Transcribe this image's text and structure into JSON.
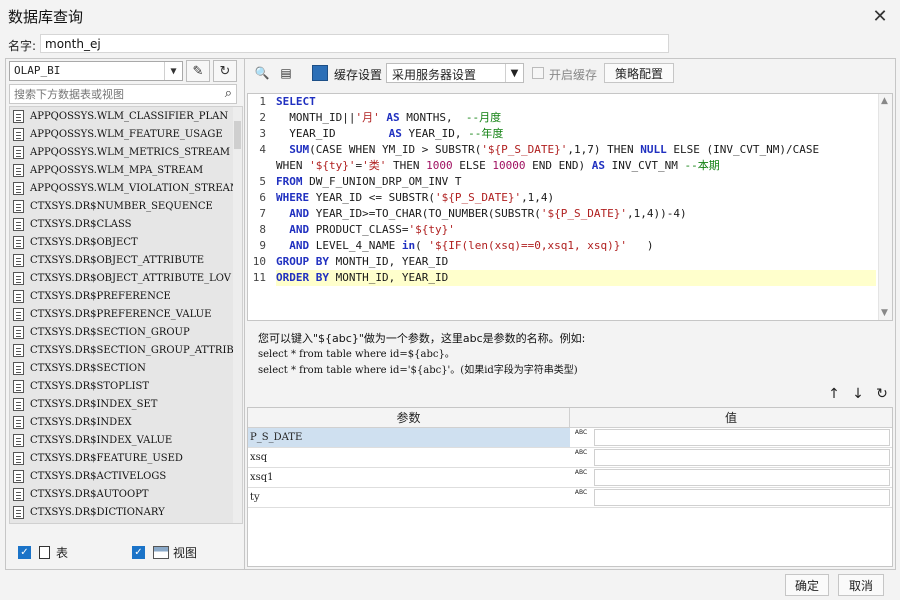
{
  "window": {
    "title": "数据库查询"
  },
  "name_field": {
    "label": "名字:",
    "value": "month_ej"
  },
  "left": {
    "datasource": "OLAP_BI",
    "search_placeholder": "搜索下方数据表或视图",
    "tables": [
      "APPQOSSYS.WLM_CLASSIFIER_PLAN",
      "APPQOSSYS.WLM_FEATURE_USAGE",
      "APPQOSSYS.WLM_METRICS_STREAM",
      "APPQOSSYS.WLM_MPA_STREAM",
      "APPQOSSYS.WLM_VIOLATION_STREAM",
      "CTXSYS.DR$NUMBER_SEQUENCE",
      "CTXSYS.DR$CLASS",
      "CTXSYS.DR$OBJECT",
      "CTXSYS.DR$OBJECT_ATTRIBUTE",
      "CTXSYS.DR$OBJECT_ATTRIBUTE_LOV",
      "CTXSYS.DR$PREFERENCE",
      "CTXSYS.DR$PREFERENCE_VALUE",
      "CTXSYS.DR$SECTION_GROUP",
      "CTXSYS.DR$SECTION_GROUP_ATTRIBUTE",
      "CTXSYS.DR$SECTION",
      "CTXSYS.DR$STOPLIST",
      "CTXSYS.DR$INDEX_SET",
      "CTXSYS.DR$INDEX",
      "CTXSYS.DR$INDEX_VALUE",
      "CTXSYS.DR$FEATURE_USED",
      "CTXSYS.DR$ACTIVELOGS",
      "CTXSYS.DR$AUTOOPT",
      "CTXSYS.DR$DICTIONARY"
    ],
    "check_table": "表",
    "check_view": "视图"
  },
  "toolbar": {
    "cache_label": "缓存设置",
    "cache_option": "采用服务器设置",
    "enable_cache": "开启缓存",
    "policy_button": "策略配置"
  },
  "editor": {
    "line_numbers": [
      "1",
      "2",
      "3",
      "4",
      "",
      "5",
      "6",
      "7",
      "8",
      "9",
      "10",
      "11"
    ],
    "lines": [
      [
        {
          "t": "kw",
          "v": "SELECT"
        }
      ],
      [
        {
          "t": "fn",
          "v": "  MONTH_ID||"
        },
        {
          "t": "str",
          "v": "'月'"
        },
        {
          "t": "fn",
          "v": " "
        },
        {
          "t": "kw",
          "v": "AS"
        },
        {
          "t": "fn",
          "v": " MONTHS,  "
        },
        {
          "t": "cm",
          "v": "--月度"
        }
      ],
      [
        {
          "t": "fn",
          "v": "  YEAR_ID        "
        },
        {
          "t": "kw",
          "v": "AS"
        },
        {
          "t": "fn",
          "v": " YEAR_ID, "
        },
        {
          "t": "cm",
          "v": "--年度"
        }
      ],
      [
        {
          "t": "fn",
          "v": "  "
        },
        {
          "t": "kw",
          "v": "SUM"
        },
        {
          "t": "fn",
          "v": "(CASE WHEN YM_ID > SUBSTR("
        },
        {
          "t": "str",
          "v": "'${P_S_DATE}'"
        },
        {
          "t": "fn",
          "v": ",1,7) THEN "
        },
        {
          "t": "kw",
          "v": "NULL"
        },
        {
          "t": "fn",
          "v": " ELSE (INV_CVT_NM)/CASE"
        }
      ],
      [
        {
          "t": "fn",
          "v": "WHEN "
        },
        {
          "t": "str",
          "v": "'${ty}'"
        },
        {
          "t": "fn",
          "v": "="
        },
        {
          "t": "str",
          "v": "'类'"
        },
        {
          "t": "fn",
          "v": " THEN "
        },
        {
          "t": "num",
          "v": "1000"
        },
        {
          "t": "fn",
          "v": " ELSE "
        },
        {
          "t": "num",
          "v": "10000"
        },
        {
          "t": "fn",
          "v": " END END) "
        },
        {
          "t": "kw",
          "v": "AS"
        },
        {
          "t": "fn",
          "v": " INV_CVT_NM "
        },
        {
          "t": "cm",
          "v": "--本期"
        }
      ],
      [
        {
          "t": "kw",
          "v": "FROM"
        },
        {
          "t": "fn",
          "v": " DW_F_UNION_DRP_OM_INV T"
        }
      ],
      [
        {
          "t": "kw",
          "v": "WHERE"
        },
        {
          "t": "fn",
          "v": " YEAR_ID <= SUBSTR("
        },
        {
          "t": "str",
          "v": "'${P_S_DATE}'"
        },
        {
          "t": "fn",
          "v": ",1,4)"
        }
      ],
      [
        {
          "t": "fn",
          "v": "  "
        },
        {
          "t": "kw",
          "v": "AND"
        },
        {
          "t": "fn",
          "v": " YEAR_ID>=TO_CHAR(TO_NUMBER(SUBSTR("
        },
        {
          "t": "str",
          "v": "'${P_S_DATE}'"
        },
        {
          "t": "fn",
          "v": ",1,4))-4)"
        }
      ],
      [
        {
          "t": "fn",
          "v": "  "
        },
        {
          "t": "kw",
          "v": "AND"
        },
        {
          "t": "fn",
          "v": " PRODUCT_CLASS="
        },
        {
          "t": "str",
          "v": "'${ty}'"
        }
      ],
      [
        {
          "t": "fn",
          "v": "  "
        },
        {
          "t": "kw",
          "v": "AND"
        },
        {
          "t": "fn",
          "v": " LEVEL_4_NAME "
        },
        {
          "t": "kw",
          "v": "in"
        },
        {
          "t": "fn",
          "v": "( "
        },
        {
          "t": "str",
          "v": "'${IF(len(xsq)==0,xsq1, xsq)}'"
        },
        {
          "t": "fn",
          "v": "   )"
        }
      ],
      [
        {
          "t": "kw",
          "v": "GROUP BY"
        },
        {
          "t": "fn",
          "v": " MONTH_ID, YEAR_ID"
        }
      ],
      [
        {
          "t": "kw",
          "v": "ORDER BY"
        },
        {
          "t": "fn",
          "v": " MONTH_ID, YEAR_ID"
        }
      ]
    ]
  },
  "help": {
    "line1": "您可以键入\"${abc}\"做为一个参数，这里abc是参数的名称。例如:",
    "line2": "select * from table where id=${abc}。",
    "line3": "select * from table where id='${abc}'。(如果id字段为字符串类型)"
  },
  "params": {
    "col_param": "参数",
    "col_value": "值",
    "type_label": "ABC",
    "rows": [
      "P_S_DATE",
      "xsq",
      "xsq1",
      "ty"
    ]
  },
  "footer": {
    "ok": "确定",
    "cancel": "取消"
  }
}
